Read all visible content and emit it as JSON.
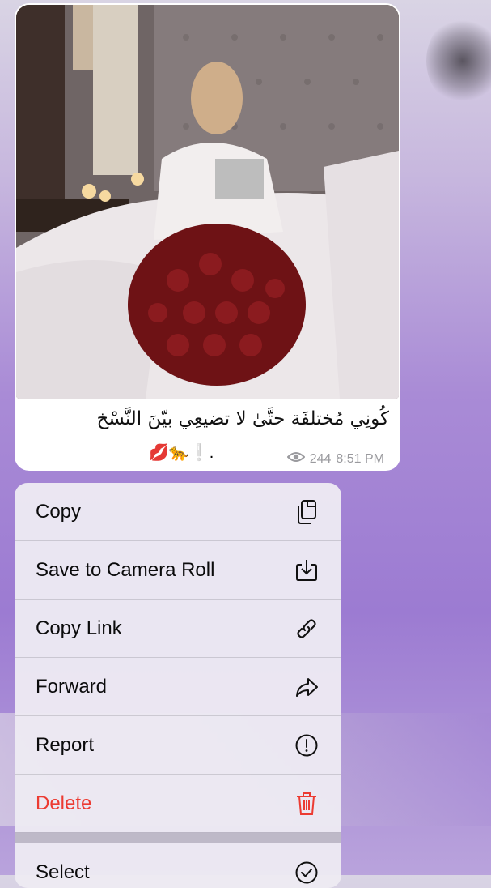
{
  "message": {
    "caption": "كُونِي مُختلفَة حتَّىٰ لا تضيعِي بيّنَ النَّسْخ",
    "caption_emojis": "💋🐆❕.",
    "views": "244",
    "time": "8:51 PM",
    "icons": [
      "eye-icon"
    ]
  },
  "menu": {
    "items": [
      {
        "label": "Copy",
        "icon": "copy-icon"
      },
      {
        "label": "Save to Camera Roll",
        "icon": "download-icon"
      },
      {
        "label": "Copy Link",
        "icon": "link-icon"
      },
      {
        "label": "Forward",
        "icon": "forward-icon"
      },
      {
        "label": "Report",
        "icon": "report-icon"
      },
      {
        "label": "Delete",
        "icon": "trash-icon",
        "color": "#ec3b32"
      },
      {
        "label": "Select",
        "icon": "checkmark-circle-icon"
      }
    ]
  },
  "colors": {
    "danger": "#ec3b32",
    "menu_background": "#edeaf2",
    "bubble": "#ffffff"
  }
}
